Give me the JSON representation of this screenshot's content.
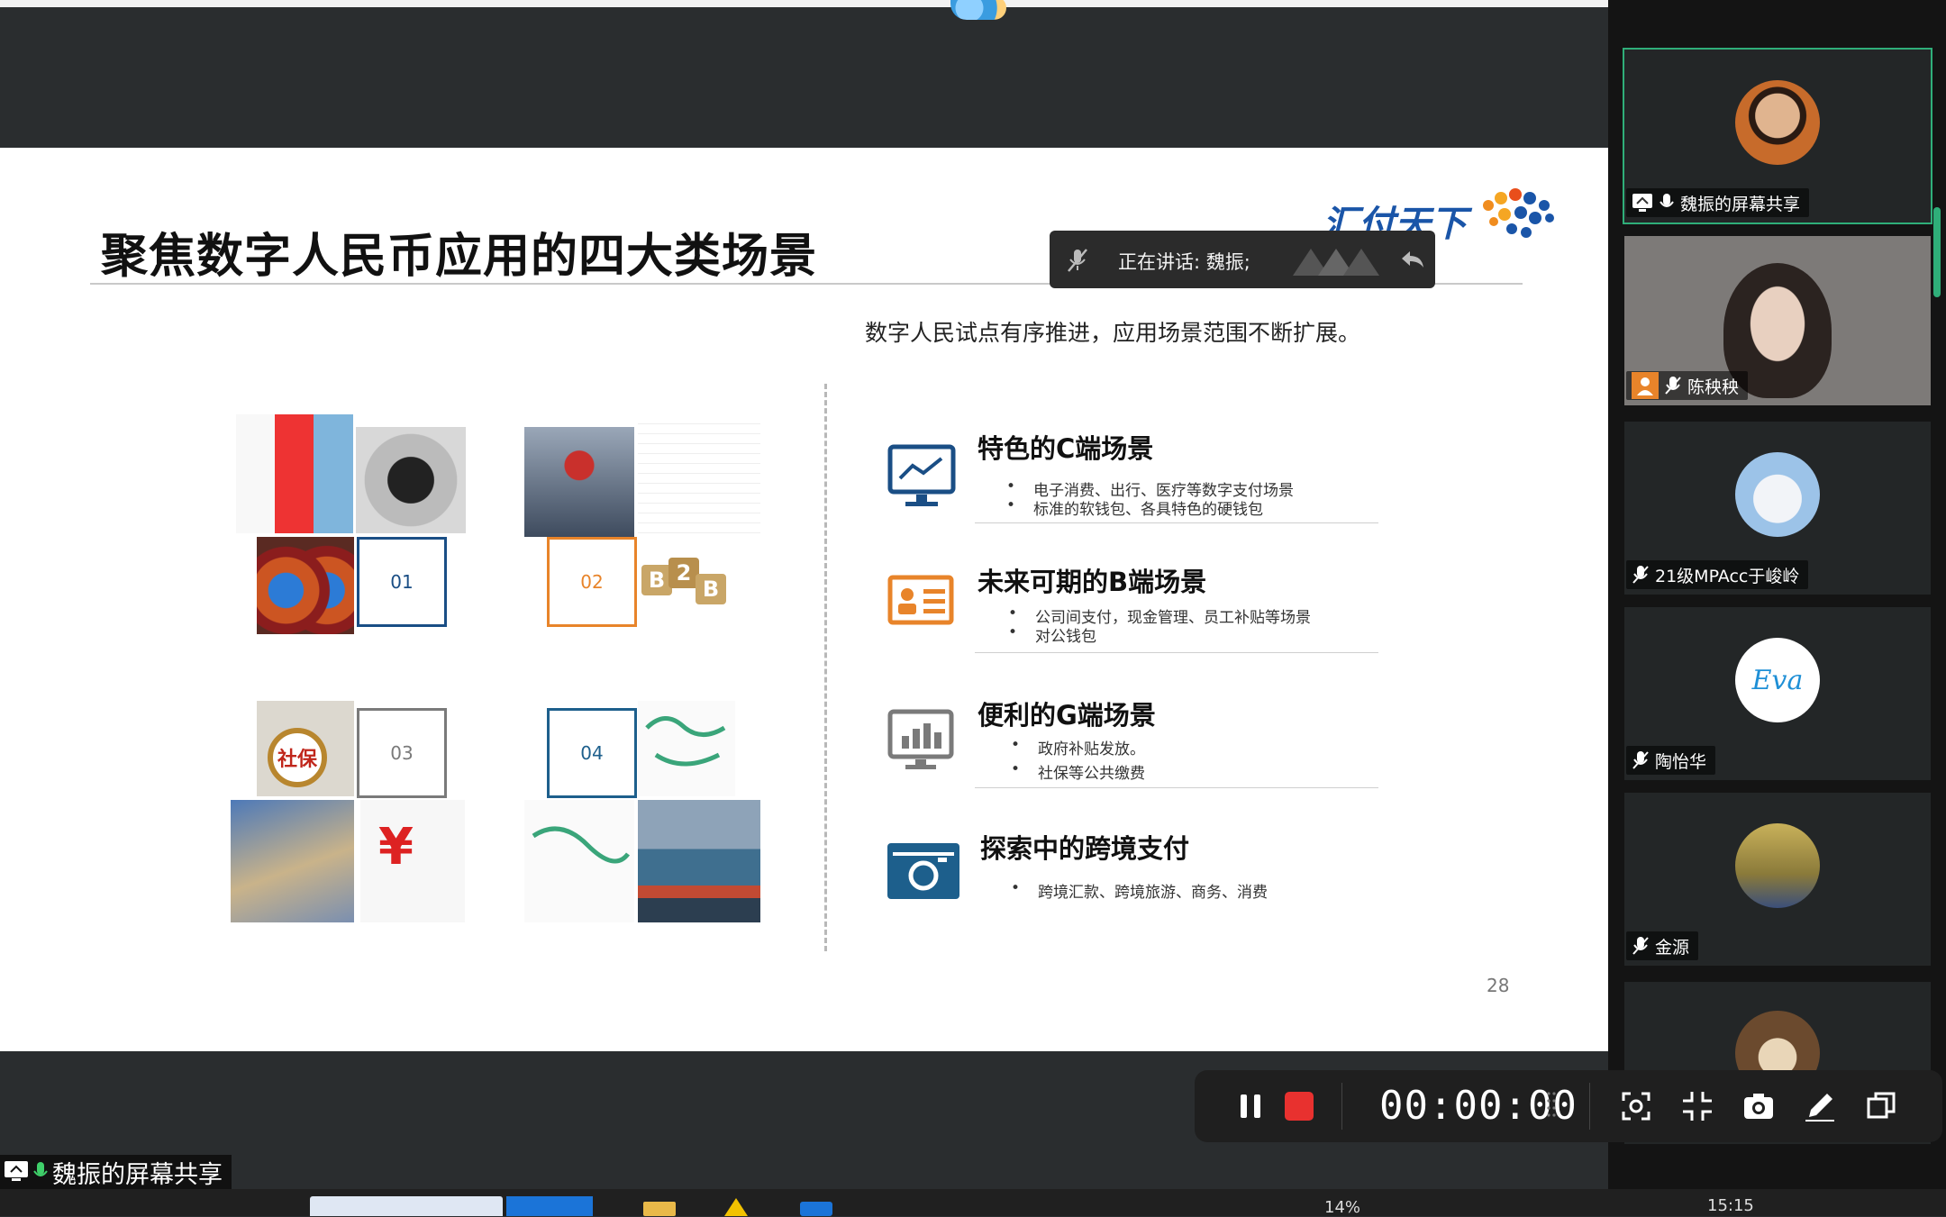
{
  "slide": {
    "title": "聚焦数字人民币应用的四大类场景",
    "subtitle": "数字人民试点有序推进，应用场景范围不断扩展。",
    "brand": "汇付天下",
    "page_number": "28",
    "quadrant_numbers": [
      "01",
      "02",
      "03",
      "04"
    ],
    "scenarios": [
      {
        "title": "特色的C端场景",
        "bullets": [
          "电子消费、出行、医疗等数字支付场景",
          "标准的软钱包、各具特色的硬钱包"
        ],
        "icon": "monitor-chart-icon"
      },
      {
        "title": "未来可期的B端场景",
        "bullets": [
          "公司间支付，现金管理、员工补贴等场景",
          "对公钱包"
        ],
        "icon": "id-card-icon"
      },
      {
        "title": "便利的G端场景",
        "bullets": [
          "政府补贴发放。",
          "社保等公共缴费"
        ],
        "icon": "bar-chart-monitor-icon"
      },
      {
        "title": "探索中的跨境支付",
        "bullets": [
          "跨境汇款、跨境旅游、商务、消费"
        ],
        "icon": "camera-icon"
      }
    ],
    "tile_labels": {
      "shebao": "社保",
      "b2b": [
        "B",
        "2",
        "B"
      ]
    }
  },
  "speaking": {
    "text": "正在讲话: 魏振;"
  },
  "participants": [
    {
      "name": "魏振的屏幕共享",
      "active": true
    },
    {
      "name": "陈秧秧",
      "active": false
    },
    {
      "name": "21级MPAcc于峻岭",
      "active": false
    },
    {
      "name": "陶怡华",
      "active": false,
      "avatar_text": "Eva"
    },
    {
      "name": "金源",
      "active": false
    },
    {
      "name": "",
      "active": false
    }
  ],
  "recorder": {
    "timer": "00:00:00"
  },
  "share_label": "魏振的屏幕共享",
  "taskbar": {
    "battery_pct": "14%",
    "time": "15:15"
  },
  "colors": {
    "navy": "#1a4e85",
    "orange": "#e8842a",
    "gray": "#7a7a7a",
    "teal": "#1d5f8c",
    "accent_green": "#2fae79"
  }
}
